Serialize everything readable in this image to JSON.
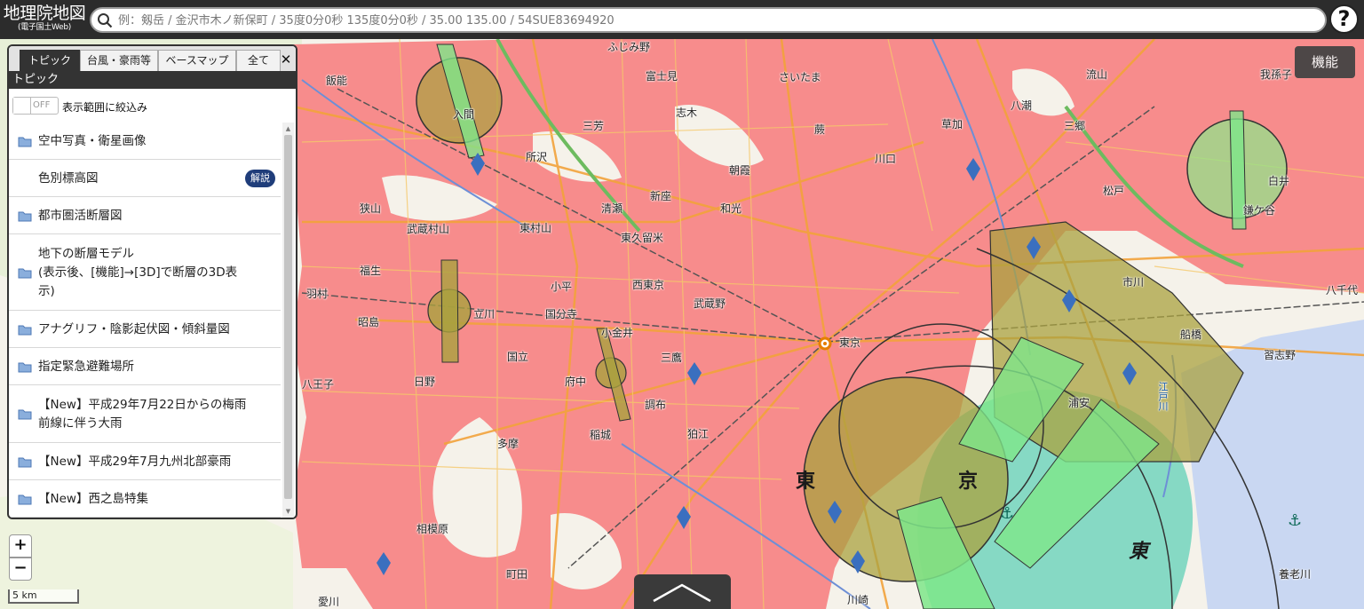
{
  "header": {
    "logo_main": "地理院地図",
    "logo_sub": "(電子国土Web)",
    "search_placeholder": "例：剱岳 / 金沢市木ノ新保町 / 35度0分0秒 135度0分0秒 / 35.00 135.00 / 54SUE83694920",
    "help_label": "?"
  },
  "feature_button": "機能",
  "panel": {
    "tabs": [
      "トピック",
      "台風・豪雨等",
      "ベースマップ",
      "全て"
    ],
    "close_label": "✕",
    "title": "トピック",
    "filter": {
      "state": "OFF",
      "label": "表示範囲に絞込み"
    },
    "items": [
      {
        "label": "空中写真・衛星画像",
        "folder": true
      },
      {
        "label": "色別標高図",
        "folder": false,
        "badge": "解説"
      },
      {
        "label": "都市圏活断層図",
        "folder": true
      },
      {
        "label": "地下の断層モデル\n(表示後、[機能]→[3D]で断層の3D表\n示)",
        "folder": true
      },
      {
        "label": "アナグリフ・陰影起伏図・傾斜量図",
        "folder": true
      },
      {
        "label": "指定緊急避難場所",
        "folder": true
      },
      {
        "label": "【New】平成29年7月22日からの梅雨\n前線に伴う大雨",
        "folder": true
      },
      {
        "label": "【New】平成29年7月九州北部豪雨",
        "folder": true
      },
      {
        "label": "【New】西之島特集",
        "folder": true
      }
    ]
  },
  "zoom": {
    "in": "+",
    "out": "−"
  },
  "scale_label": "5 km",
  "map": {
    "colors": {
      "urban": "#f78c8c",
      "airport_zone": "#a9a13f",
      "approach": "#7ee68a",
      "sea": "#86d9c4",
      "water": "#c9d7f2"
    },
    "labels": [
      "さいたま",
      "富士見",
      "ふじみ野",
      "飯能",
      "志木",
      "三芳",
      "所沢",
      "朝霞",
      "新座",
      "清瀬",
      "入間",
      "狭山",
      "和光",
      "東久留米",
      "東村山",
      "武蔵村山",
      "小平",
      "西東京",
      "武蔵野",
      "国分寺",
      "昭島",
      "立川",
      "国立",
      "小金井",
      "三鷹",
      "府中",
      "調布",
      "日野",
      "八王子",
      "多摩",
      "稲城",
      "狛江",
      "町田",
      "相模原",
      "愛川",
      "福生",
      "羽村",
      "東京",
      "川口",
      "蕨",
      "草加",
      "八潮",
      "三郷",
      "流山",
      "松戸",
      "市川",
      "船橋",
      "浦安",
      "習志野",
      "八千代",
      "白井",
      "鎌ケ谷",
      "我孫子",
      "川崎",
      "江戸川",
      "養老川",
      "東",
      "京"
    ]
  }
}
